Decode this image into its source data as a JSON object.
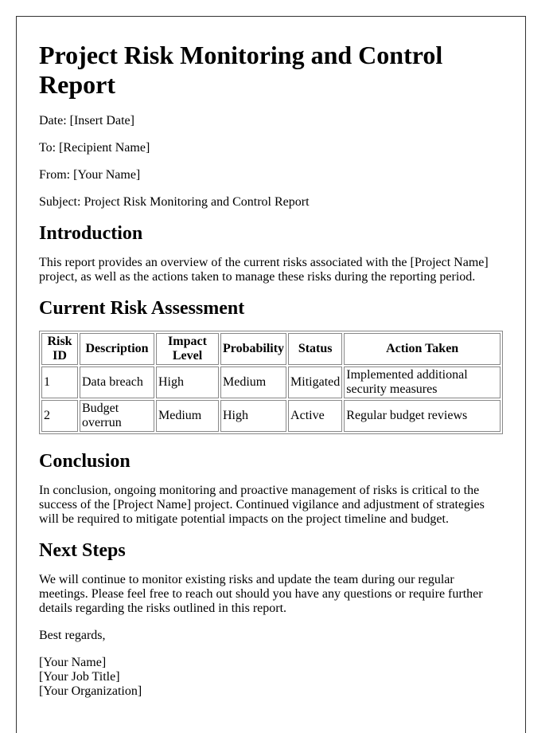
{
  "title": "Project Risk Monitoring and Control Report",
  "meta": {
    "date": "Date: [Insert Date]",
    "to": "To: [Recipient Name]",
    "from": "From: [Your Name]",
    "subject": "Subject: Project Risk Monitoring and Control Report"
  },
  "introduction": {
    "heading": "Introduction",
    "text": "This report provides an overview of the current risks associated with the [Project Name] project, as well as the actions taken to manage these risks during the reporting period."
  },
  "assessment": {
    "heading": "Current Risk Assessment",
    "columns": [
      "Risk ID",
      "Description",
      "Impact Level",
      "Probability",
      "Status",
      "Action Taken"
    ],
    "rows": [
      [
        "1",
        "Data breach",
        "High",
        "Medium",
        "Mitigated",
        "Implemented additional security measures"
      ],
      [
        "2",
        "Budget overrun",
        "Medium",
        "High",
        "Active",
        "Regular budget reviews"
      ]
    ]
  },
  "conclusion": {
    "heading": "Conclusion",
    "text": "In conclusion, ongoing monitoring and proactive management of risks is critical to the success of the [Project Name] project. Continued vigilance and adjustment of strategies will be required to mitigate potential impacts on the project timeline and budget."
  },
  "next_steps": {
    "heading": "Next Steps",
    "text": "We will continue to monitor existing risks and update the team during our regular meetings. Please feel free to reach out should you have any questions or require further details regarding the risks outlined in this report."
  },
  "closing": "Best regards,",
  "signature": [
    "[Your Name]",
    "[Your Job Title]",
    "[Your Organization]"
  ]
}
